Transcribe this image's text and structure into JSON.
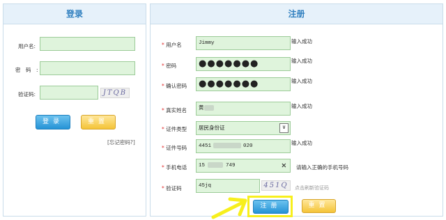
{
  "login": {
    "title": "登录",
    "username_label": "用户名:",
    "password_label": "密　码　:",
    "captcha_label": "验证码:",
    "captcha_text": "JTQB",
    "login_button": "登录",
    "reset_button": "重置",
    "forgot_link": "[忘记密码?]"
  },
  "register": {
    "title": "注册",
    "fields": {
      "username": {
        "label": "用户名",
        "value": "Jimmy",
        "status": "输入成功"
      },
      "password": {
        "label": "密码",
        "value": "●●●●●●●",
        "status": "输入成功"
      },
      "confirm_password": {
        "label": "确认密码",
        "value": "●●●●●●●",
        "status": "输入成功"
      },
      "real_name": {
        "label": "真实姓名",
        "value": "黄",
        "status": "输入成功"
      },
      "id_type": {
        "label": "证件类型",
        "value": "居民身份证"
      },
      "id_number": {
        "label": "证件号码",
        "value_prefix": "4451",
        "value_suffix": "020",
        "status": "输入成功"
      },
      "phone": {
        "label": "手机电话",
        "value_prefix": "15",
        "value_suffix": "749",
        "status": "请输入正确的手机号码"
      },
      "captcha": {
        "label": "验证码",
        "value": "45jq",
        "captcha_text": "451Q",
        "refresh_hint": "点击刷新验证码"
      }
    },
    "register_button": "注册",
    "reset_button": "重置"
  },
  "colors": {
    "accent": "#2f7fbf",
    "input_bg": "#dff4dc",
    "highlight": "#f7ef1d"
  }
}
